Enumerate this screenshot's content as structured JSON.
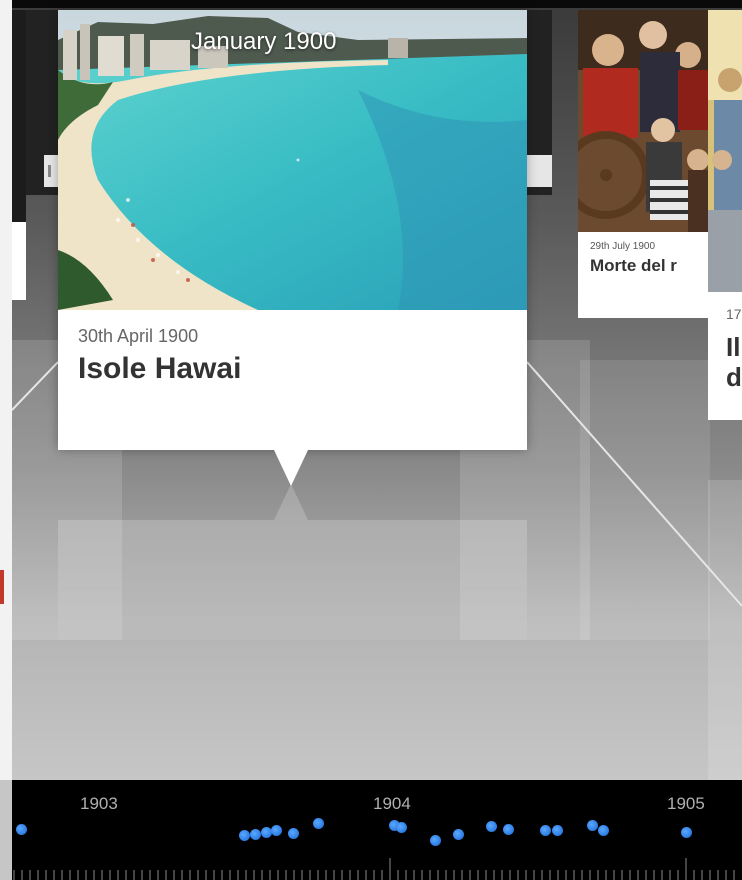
{
  "featured": {
    "overlay_date": "January 1900",
    "date": "30th April 1900",
    "title": "Isole Hawai"
  },
  "cards": [
    {
      "date": "29th July 1900",
      "title": "Morte del r"
    },
    {
      "date": "17",
      "title_line1": "Il",
      "title_line2": "d"
    }
  ],
  "timeline": {
    "years": [
      "1903",
      "1904",
      "1905"
    ],
    "event_color": "#2f86ff"
  }
}
